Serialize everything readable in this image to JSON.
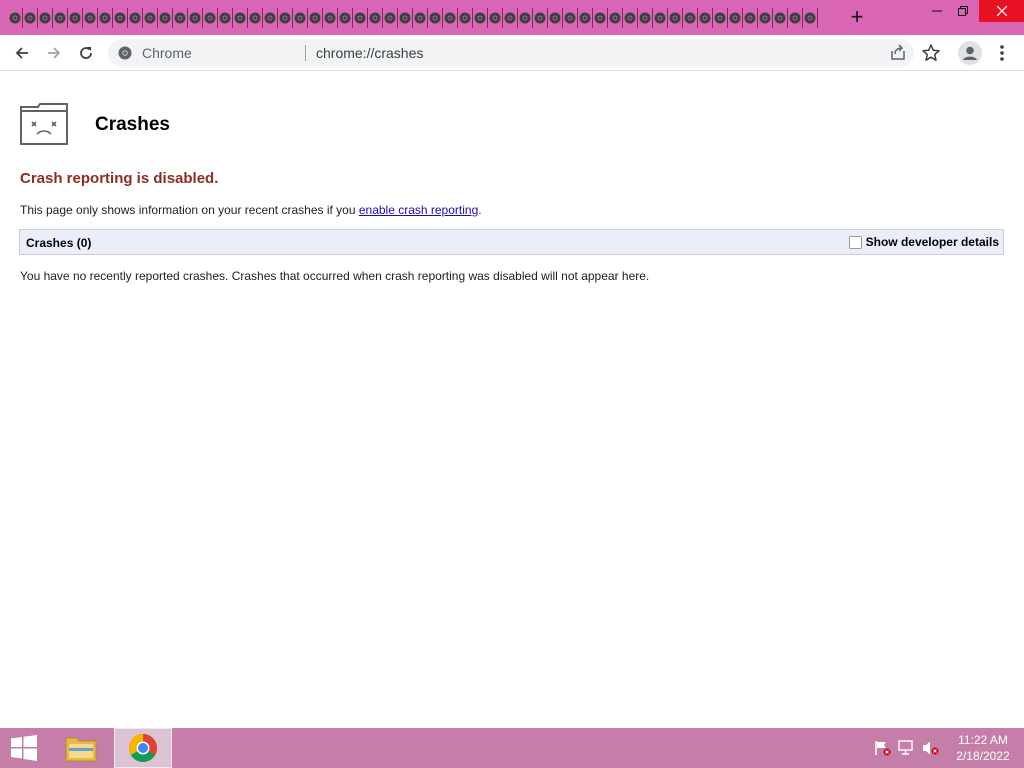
{
  "browser": {
    "tab_count": 54,
    "new_tab_label": "+",
    "omnibox": {
      "chip": "Chrome",
      "url": "chrome://crashes"
    }
  },
  "page": {
    "title": "Crashes",
    "heading": "Crash reporting is disabled.",
    "info_text": "This page only shows information on your recent crashes if you ",
    "info_link": "enable crash reporting",
    "info_suffix": ".",
    "crashes_label": "Crashes (0)",
    "developer_toggle_label": "Show developer details",
    "developer_toggle_checked": false,
    "empty_text": "You have no recently reported crashes. Crashes that occurred when crash reporting was disabled will not appear here."
  },
  "taskbar": {
    "time": "11:22 AM",
    "date": "2/18/2022"
  },
  "colors": {
    "tabstrip": "#d966b4",
    "taskbar": "#c47ea7",
    "heading": "#8b2f24",
    "link": "#1a0dab"
  }
}
